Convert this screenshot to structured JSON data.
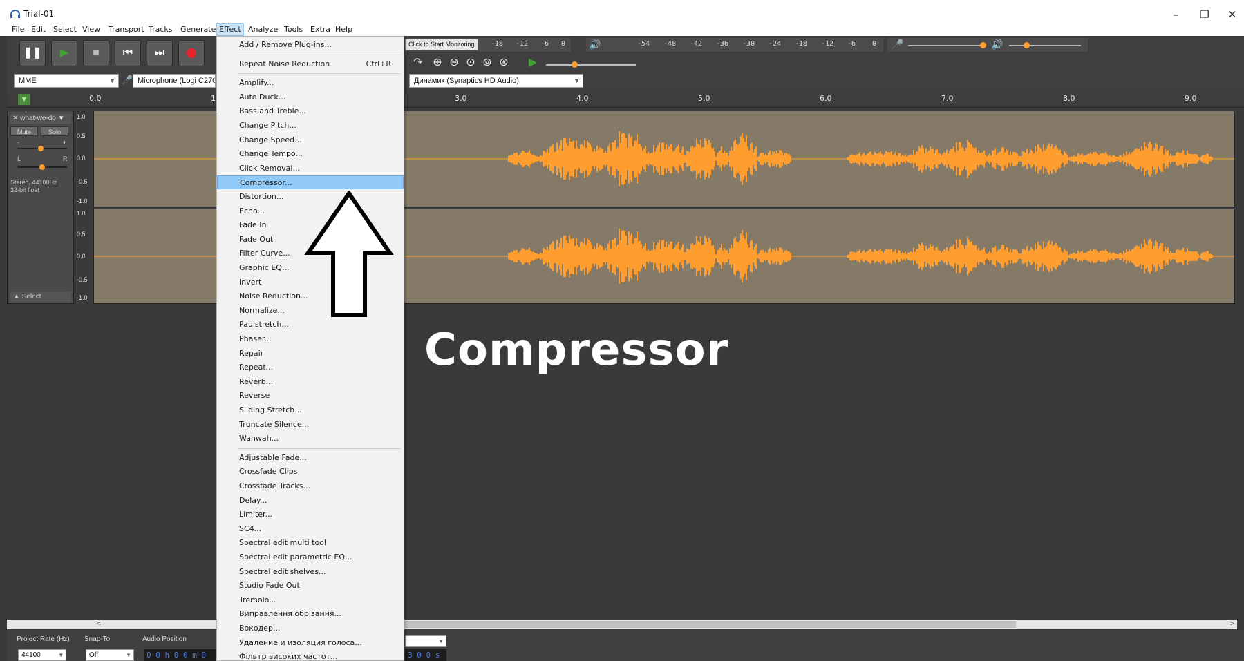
{
  "window": {
    "title": "Trial-01",
    "controls": {
      "minimize": "–",
      "maximize": "❐",
      "close": "✕"
    }
  },
  "menubar": {
    "items": [
      "File",
      "Edit",
      "Select",
      "View",
      "Transport",
      "Tracks",
      "Generate",
      "Effect",
      "Analyze",
      "Tools",
      "Extra",
      "Help"
    ],
    "active": "Effect"
  },
  "toolbar": {
    "monitor_label": "Click to Start Monitoring",
    "rec_meter_ticks": [
      "-18",
      "-12",
      "-6",
      "0"
    ],
    "play_meter_ticks": [
      "-54",
      "-48",
      "-42",
      "-36",
      "-30",
      "-24",
      "-18",
      "-12",
      "-6",
      "0"
    ],
    "accent_play": "#3ea531",
    "accent_record": "#e8242c"
  },
  "devices": {
    "host": "MME",
    "mic": "Microphone (Logi C270",
    "output": "Динамик (Synaptics HD Audio)"
  },
  "ruler": {
    "ticks": [
      "0.0",
      "1",
      "3.0",
      "4.0",
      "5.0",
      "6.0",
      "7.0",
      "8.0",
      "9.0"
    ]
  },
  "track": {
    "name": "what-we-do",
    "mute": "Mute",
    "solo": "Solo",
    "info_line1": "Stereo, 44100Hz",
    "info_line2": "32-bit float",
    "select": "Select",
    "channel1_scale": [
      "1.0",
      "0.5",
      "0.0",
      "-0.5",
      "-1.0"
    ],
    "channel2_scale": [
      "1.0",
      "0.5",
      "0.0",
      "-0.5",
      "-1.0"
    ],
    "pan_l": "L",
    "pan_r": "R",
    "gain_minus": "-",
    "gain_plus": "+",
    "wave_color": "#ff9d2f",
    "bg_color": "#857a67"
  },
  "selection_bar": {
    "project_rate_label": "Project Rate (Hz)",
    "project_rate": "44100",
    "snap_label": "Snap-To",
    "snap_value": "Off",
    "audio_pos_label": "Audio Position",
    "audio_pos": "0 0 h 0 0 m 0 0 0",
    "end_time": "3 0 0 s"
  },
  "effect_menu": {
    "group1": [
      {
        "label": "Add / Remove Plug-ins..."
      }
    ],
    "group2": [
      {
        "label": "Repeat Noise Reduction",
        "shortcut": "Ctrl+R"
      }
    ],
    "group3": [
      {
        "label": "Amplify..."
      },
      {
        "label": "Auto Duck..."
      },
      {
        "label": "Bass and Treble..."
      },
      {
        "label": "Change Pitch..."
      },
      {
        "label": "Change Speed..."
      },
      {
        "label": "Change Tempo..."
      },
      {
        "label": "Click Removal..."
      },
      {
        "label": "Compressor...",
        "highlight": true
      },
      {
        "label": "Distortion..."
      },
      {
        "label": "Echo..."
      },
      {
        "label": "Fade In"
      },
      {
        "label": "Fade Out"
      },
      {
        "label": "Filter Curve..."
      },
      {
        "label": "Graphic EQ..."
      },
      {
        "label": "Invert"
      },
      {
        "label": "Noise Reduction..."
      },
      {
        "label": "Normalize..."
      },
      {
        "label": "Paulstretch..."
      },
      {
        "label": "Phaser..."
      },
      {
        "label": "Repair"
      },
      {
        "label": "Repeat..."
      },
      {
        "label": "Reverb..."
      },
      {
        "label": "Reverse"
      },
      {
        "label": "Sliding Stretch..."
      },
      {
        "label": "Truncate Silence..."
      },
      {
        "label": "Wahwah..."
      }
    ],
    "group4": [
      {
        "label": "Adjustable Fade..."
      },
      {
        "label": "Crossfade Clips"
      },
      {
        "label": "Crossfade Tracks..."
      },
      {
        "label": "Delay..."
      },
      {
        "label": "Limiter..."
      },
      {
        "label": "SC4..."
      },
      {
        "label": "Spectral edit multi tool"
      },
      {
        "label": "Spectral edit parametric EQ..."
      },
      {
        "label": "Spectral edit shelves..."
      },
      {
        "label": "Studio Fade Out"
      },
      {
        "label": "Tremolo..."
      },
      {
        "label": "Виправлення обрізання..."
      },
      {
        "label": "Вокодер..."
      },
      {
        "label": "Удаление и изоляция голоса..."
      },
      {
        "label": "Фільтр високих частот..."
      }
    ]
  },
  "annotation": {
    "label": "Compressor"
  }
}
